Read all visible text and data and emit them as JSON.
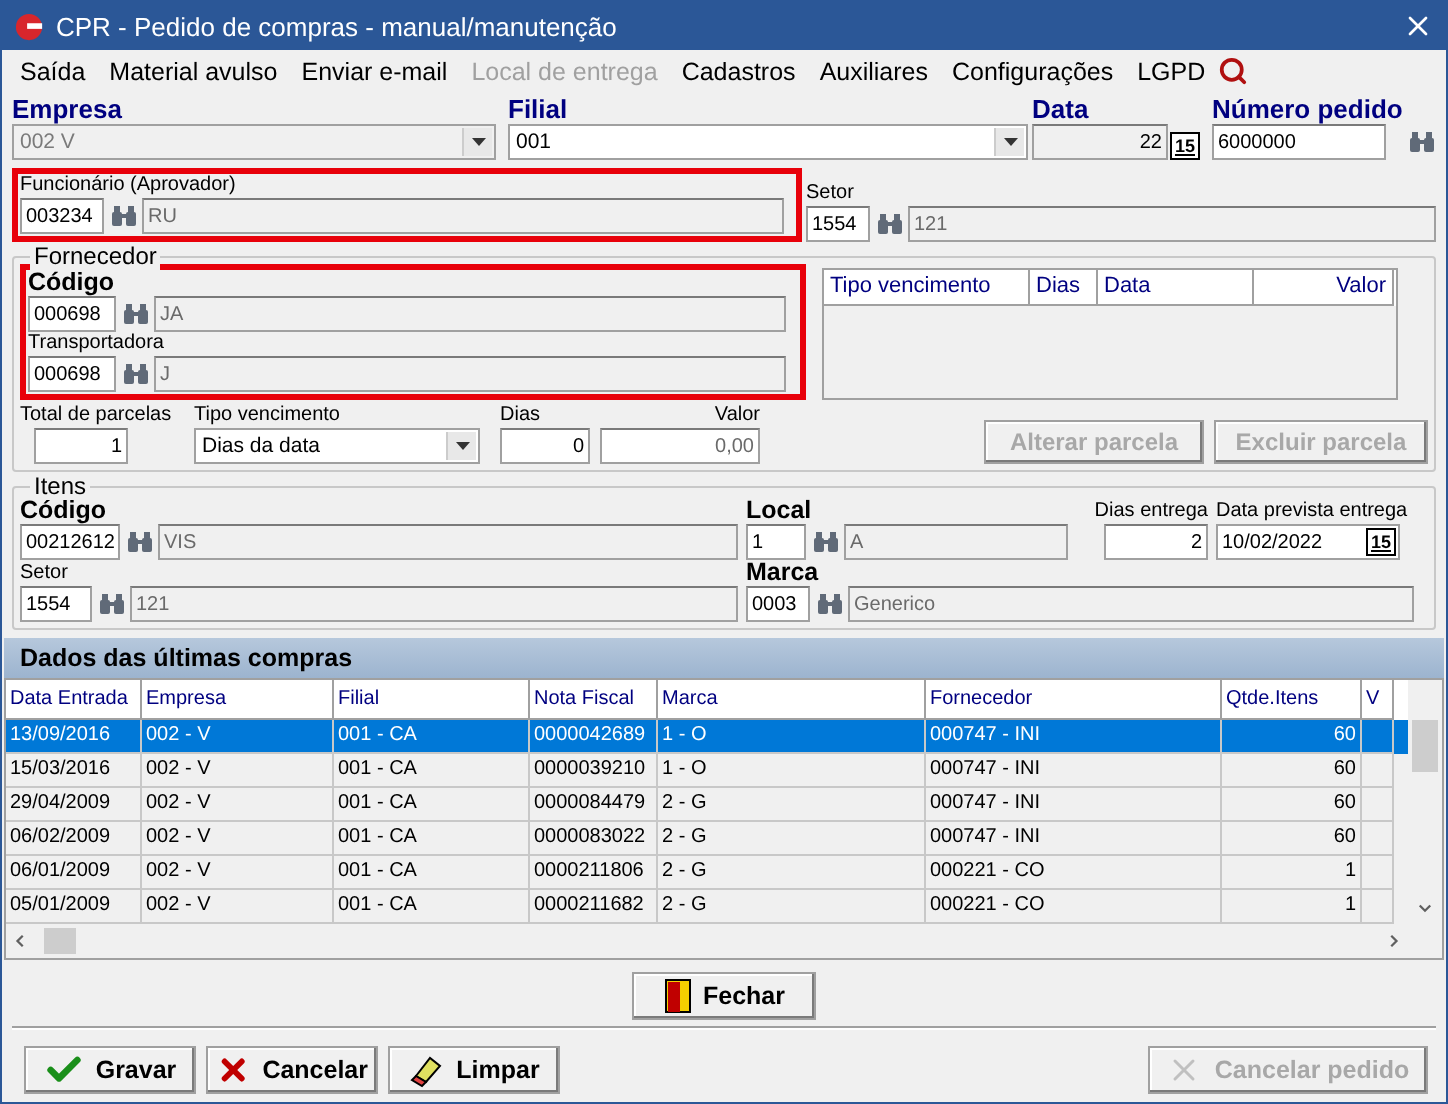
{
  "window": {
    "title": "CPR - Pedido de compras - manual/manutenção"
  },
  "menu": [
    {
      "label": "Saída",
      "disabled": false
    },
    {
      "label": "Material avulso",
      "disabled": false
    },
    {
      "label": "Enviar e-mail",
      "disabled": false
    },
    {
      "label": "Local de entrega",
      "disabled": true
    },
    {
      "label": "Cadastros",
      "disabled": false
    },
    {
      "label": "Auxiliares",
      "disabled": false
    },
    {
      "label": "Configurações",
      "disabled": false
    },
    {
      "label": "LGPD",
      "disabled": false
    }
  ],
  "header": {
    "empresa": {
      "label": "Empresa",
      "value": "002 V"
    },
    "filial": {
      "label": "Filial",
      "value": "001"
    },
    "data": {
      "label": "Data",
      "value": "22",
      "picker": "15"
    },
    "numero_pedido": {
      "label": "Número pedido",
      "value": "6000000"
    }
  },
  "funcionario": {
    "label": "Funcionário (Aprovador)",
    "code": "003234",
    "name": "RU"
  },
  "setor": {
    "label": "Setor",
    "code": "1554",
    "name": "121"
  },
  "fornecedor": {
    "title": "Fornecedor",
    "codigo": {
      "label": "Código",
      "code": "000698",
      "name": "JA"
    },
    "transportadora": {
      "label": "Transportadora",
      "code": "000698",
      "name": "J"
    },
    "parcelas_columns": [
      "Tipo vencimento",
      "Dias",
      "Data",
      "Valor"
    ],
    "total_parcelas": {
      "label": "Total de parcelas",
      "value": "1"
    },
    "tipo_vencimento": {
      "label": "Tipo vencimento",
      "value": "Dias da data"
    },
    "dias": {
      "label": "Dias",
      "value": "0"
    },
    "valor": {
      "label": "Valor",
      "value": "0,00"
    },
    "buttons": [
      {
        "label": "Alterar parcela",
        "disabled": true
      },
      {
        "label": "Excluir parcela",
        "disabled": true
      }
    ]
  },
  "itens": {
    "title": "Itens",
    "codigo": {
      "label": "Código",
      "code": "00212612",
      "name": "VIS"
    },
    "setor": {
      "label": "Setor",
      "code": "1554",
      "name": "121"
    },
    "local": {
      "label": "Local",
      "code": "1",
      "name": "A"
    },
    "marca": {
      "label": "Marca",
      "code": "0003",
      "name": "Generico"
    },
    "dias_entrega": {
      "label": "Dias entrega",
      "value": "2"
    },
    "data_prevista": {
      "label": "Data prevista entrega",
      "value": "10/02/2022",
      "picker": "15"
    }
  },
  "ultimas_compras": {
    "title": "Dados das últimas compras",
    "columns": [
      "Data Entrada",
      "Empresa",
      "Filial",
      "Nota Fiscal",
      "Marca",
      "Fornecedor",
      "Qtde.Itens",
      "V"
    ],
    "rows": [
      {
        "selected": true,
        "cells": [
          "13/09/2016",
          "002 - V",
          "001 - CA",
          "0000042689",
          "1 - O",
          "000747 - INI",
          "60",
          ""
        ]
      },
      {
        "selected": false,
        "cells": [
          "15/03/2016",
          "002 - V",
          "001 - CA",
          "0000039210",
          "1 - O",
          "000747 - INI",
          "60",
          ""
        ]
      },
      {
        "selected": false,
        "cells": [
          "29/04/2009",
          "002 - V",
          "001 - CA",
          "0000084479",
          "2 - G",
          "000747 - INI",
          "60",
          ""
        ]
      },
      {
        "selected": false,
        "cells": [
          "06/02/2009",
          "002 - V",
          "001 - CA",
          "0000083022",
          "2 - G",
          "000747 - INI",
          "60",
          ""
        ]
      },
      {
        "selected": false,
        "cells": [
          "06/01/2009",
          "002 - V",
          "001 - CA",
          "0000211806",
          "2 - G",
          "000221 - CO",
          "1",
          ""
        ]
      },
      {
        "selected": false,
        "cells": [
          "05/01/2009",
          "002 - V",
          "001 - CA",
          "0000211682",
          "2 - G",
          "000221 - CO",
          "1",
          ""
        ]
      }
    ]
  },
  "close_button": {
    "label": "Fechar"
  },
  "bottom_buttons": [
    {
      "label": "Gravar",
      "kind": "save",
      "disabled": false
    },
    {
      "label": "Cancelar",
      "kind": "cancel",
      "disabled": false
    },
    {
      "label": "Limpar",
      "kind": "clear",
      "disabled": false
    },
    {
      "label": "Cancelar pedido",
      "kind": "cancel-order",
      "disabled": true
    }
  ]
}
